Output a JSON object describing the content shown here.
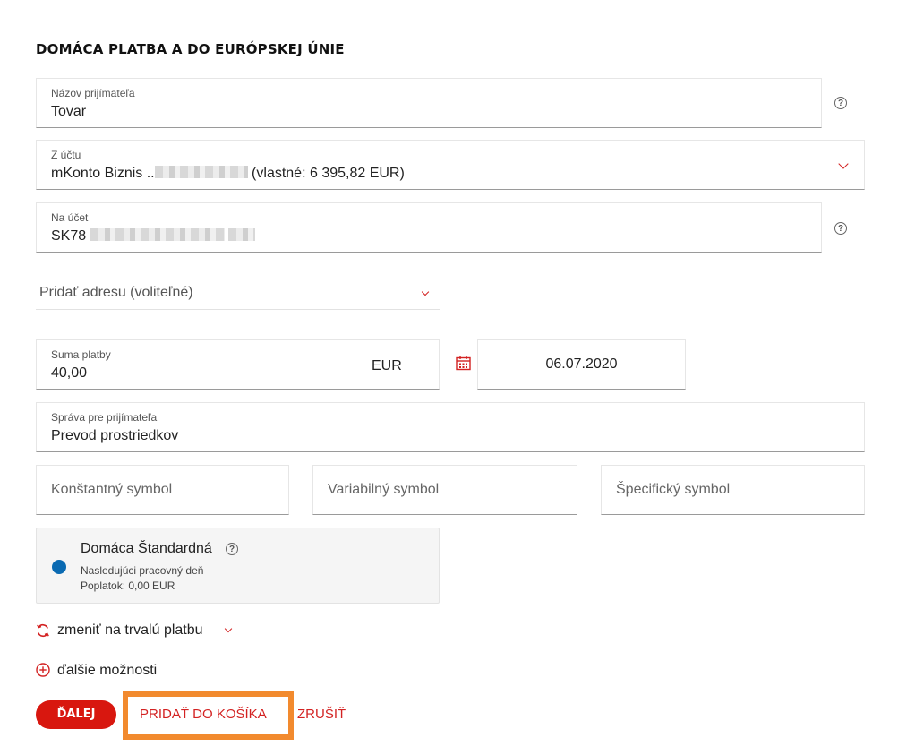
{
  "form": {
    "title": "DOMÁCA PLATBA A DO EURÓPSKEJ ÚNIE",
    "recipient": {
      "label": "Názov prijímateľa",
      "value": "Tovar"
    },
    "from_account": {
      "label": "Z účtu",
      "prefix": "mKonto Biznis ..",
      "suffix": " (vlastné: 6 395,82 EUR)"
    },
    "to_account": {
      "label": "Na účet",
      "prefix": "SK78"
    },
    "address": {
      "placeholder": "Pridať adresu (voliteľné)"
    },
    "amount": {
      "label": "Suma platby",
      "value": "40,00",
      "currency": "EUR"
    },
    "date": {
      "value": "06.07.2020"
    },
    "message": {
      "label": "Správa pre prijímateľa",
      "value": "Prevod prostriedkov"
    },
    "symbols": {
      "constant": "Konštantný symbol",
      "variable": "Variabilný symbol",
      "specific": "Špecifický symbol"
    },
    "payment_type": {
      "name": "Domáca Štandardná",
      "detail1": "Nasledujúci pracovný deň",
      "detail2": "Poplatok: 0,00 EUR"
    },
    "standing_order_link": "zmeniť na trvalú platbu",
    "more_options_link": "ďalšie možnosti"
  },
  "actions": {
    "next": "ĎALEJ",
    "add_to_cart": "PRIDAŤ DO KOŠÍKA",
    "cancel": "ZRUŠIŤ"
  },
  "colors": {
    "accent": "#d32222",
    "highlight": "#f28a2e",
    "radio": "#0a6ab2"
  }
}
